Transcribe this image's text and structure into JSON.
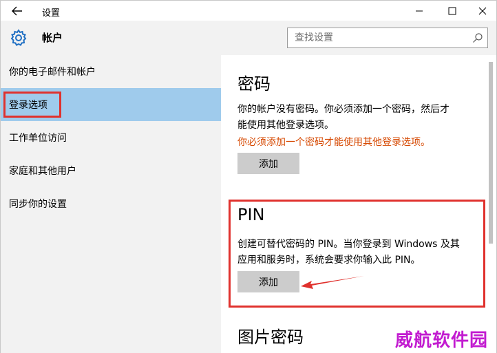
{
  "window": {
    "title": "设置"
  },
  "header": {
    "title": "帐户",
    "search_placeholder": "查找设置"
  },
  "sidebar": {
    "items": [
      {
        "label": "你的电子邮件和帐户"
      },
      {
        "label": "登录选项"
      },
      {
        "label": "工作单位访问"
      },
      {
        "label": "家庭和其他用户"
      },
      {
        "label": "同步你的设置"
      }
    ],
    "selected_index": 1
  },
  "main": {
    "password": {
      "title": "密码",
      "line1": "你的帐户没有密码。你必须添加一个密码，然后才",
      "line2": "能使用其他登录选项。",
      "warning": "你必须添加一个密码才能使用其他登录选项。",
      "add_label": "添加"
    },
    "pin": {
      "title": "PIN",
      "line1": "创建可替代密码的 PIN。当你登录到 Windows 及其",
      "line2": "应用和服务时，系统会要求你输入此 PIN。",
      "add_label": "添加"
    },
    "picture_password": {
      "title": "图片密码"
    }
  },
  "watermark": "威航软件园",
  "colors": {
    "selected_bg": "#9fcbec",
    "sidebar_bg": "#f2f2f2",
    "highlight_red": "#e0312d",
    "warning_orange": "#d64800",
    "button_gray": "#cccccc",
    "watermark": "#c21bd0"
  },
  "icons": [
    "back-arrow-icon",
    "minimize-icon",
    "maximize-icon",
    "close-icon",
    "gear-icon",
    "search-icon",
    "arrow-annotation-icon"
  ]
}
